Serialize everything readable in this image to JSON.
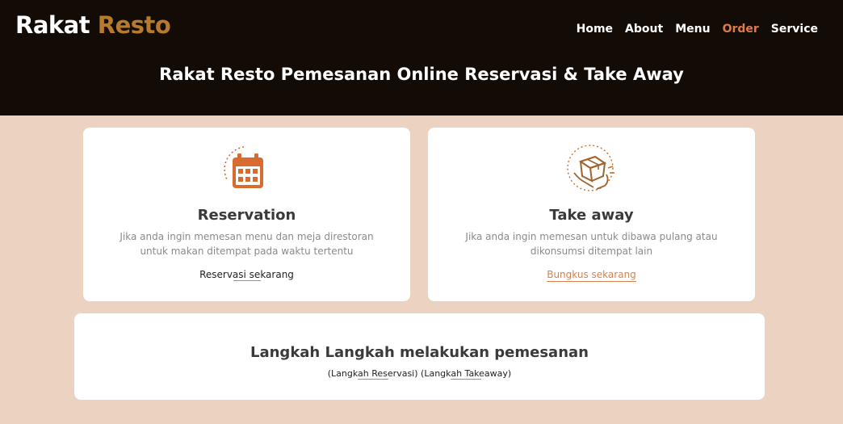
{
  "brand": {
    "part1": "Rakat",
    "part2": "Resto"
  },
  "nav": {
    "items": [
      {
        "label": "Home"
      },
      {
        "label": "About"
      },
      {
        "label": "Menu"
      },
      {
        "label": "Order"
      },
      {
        "label": "Service"
      }
    ],
    "active": "Order"
  },
  "hero": {
    "title": "Rakat Resto Pemesanan Online Reservasi & Take Away"
  },
  "cards": {
    "reservation": {
      "icon": "calendar-icon",
      "title": "Reservation",
      "description": "Jika anda ingin memesan menu dan meja direstoran untuk makan ditempat pada waktu tertentu",
      "link": "Reservasi sekarang"
    },
    "takeaway": {
      "icon": "takeaway-box-icon",
      "title": "Take away",
      "description": "Jika anda ingin memesan untuk dibawa pulang atau dikonsumsi ditempat lain",
      "link": "Bungkus sekarang"
    }
  },
  "steps": {
    "title": "Langkah Langkah melakukan pemesanan",
    "link_reservasi": "(Langkah Reservasi)",
    "link_takeaway": "(Langkah Takeaway)"
  },
  "colors": {
    "header_bg": "#130b05",
    "page_bg": "#ecd3c1",
    "accent": "#e07a46",
    "brand_gold": "#b57a2c",
    "icon_orange": "#d96a30"
  }
}
